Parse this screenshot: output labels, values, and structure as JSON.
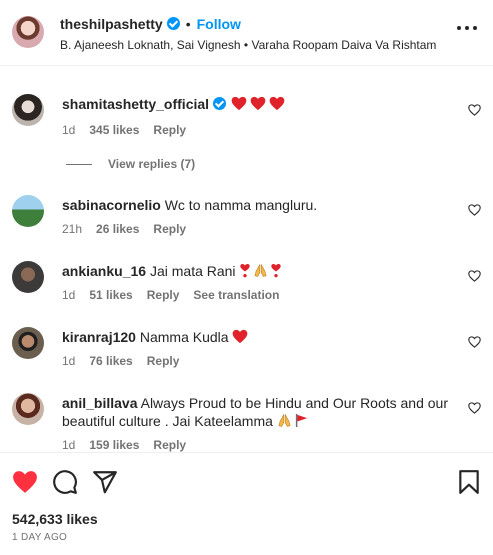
{
  "post": {
    "username": "theshilpashetty",
    "follow_label": "Follow",
    "separator": "•",
    "audio": "B. Ajaneesh Loknath, Sai Vignesh • Varaha Roopam Daiva Va Rishtam"
  },
  "comments": [
    {
      "username": "shamitashetty_official",
      "text": "",
      "verified": true,
      "emojis": [
        "red-heart",
        "red-heart",
        "red-heart"
      ],
      "time": "1d",
      "likes": "345 likes",
      "reply": "Reply",
      "view_replies": "View replies (7)"
    },
    {
      "username": "sabinacornelio",
      "text": "Wc to namma mangluru.",
      "time": "21h",
      "likes": "26 likes",
      "reply": "Reply"
    },
    {
      "username": "ankianku_16",
      "text": "Jai mata Rani",
      "emojis": [
        "heart-exclamation",
        "folded-hands",
        "heart-exclamation"
      ],
      "time": "1d",
      "likes": "51 likes",
      "reply": "Reply",
      "translation": "See translation"
    },
    {
      "username": "kiranraj120",
      "text": "Namma Kudla",
      "emojis": [
        "red-heart"
      ],
      "time": "1d",
      "likes": "76 likes",
      "reply": "Reply"
    },
    {
      "username": "anil_billava",
      "text": "Always Proud to be Hindu and Our Roots and our beautiful culture . Jai Kateelamma",
      "emojis": [
        "folded-hands",
        "triangular-flag"
      ],
      "time": "1d",
      "likes": "159 likes",
      "reply": "Reply"
    }
  ],
  "footer": {
    "likes": "542,633 likes",
    "time": "1 DAY AGO"
  },
  "colors": {
    "accent": "#0095f6",
    "like_red": "#ff3040",
    "secondary_text": "#737373"
  }
}
